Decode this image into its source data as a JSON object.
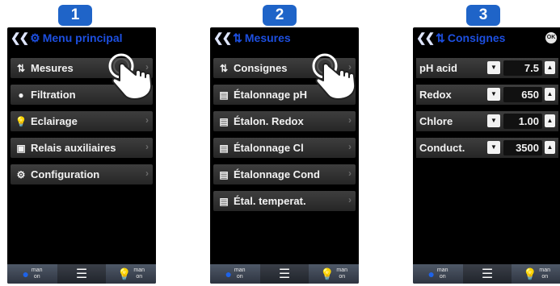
{
  "panels": [
    {
      "step": "1",
      "title": "Menu principal",
      "items": [
        {
          "label": "Mesures",
          "icon": "measures-icon"
        },
        {
          "label": "Filtration",
          "icon": "pump-icon"
        },
        {
          "label": "Eclairage",
          "icon": "light-icon"
        },
        {
          "label": "Relais auxiliaires",
          "icon": "relay-icon"
        },
        {
          "label": "Configuration",
          "icon": "config-icon"
        }
      ]
    },
    {
      "step": "2",
      "title": "Mesures",
      "items": [
        {
          "label": "Consignes",
          "icon": "measures-icon"
        },
        {
          "label": "Étalonnage pH",
          "icon": "calibration-icon"
        },
        {
          "label": "Étalon. Redox",
          "icon": "calibration-icon"
        },
        {
          "label": "Étalonnage Cl",
          "icon": "calibration-icon"
        },
        {
          "label": "Étalonnage Cond",
          "icon": "calibration-icon"
        },
        {
          "label": "Étal. temperat.",
          "icon": "calibration-icon"
        }
      ]
    },
    {
      "step": "3",
      "title": "Consignes",
      "ok_label": "OK",
      "setpoints": [
        {
          "label": "pH acid",
          "value": "7.5"
        },
        {
          "label": "Redox",
          "value": "650"
        },
        {
          "label": "Chlore",
          "value": "1.00"
        },
        {
          "label": "Conduct.",
          "value": "3500"
        }
      ]
    }
  ],
  "bottom_bar": {
    "mode_line1": "man",
    "mode_line2": "on"
  },
  "colors": {
    "badge": "#1f64c8",
    "title": "#1d4fe0",
    "screen_bg": "#000000"
  }
}
